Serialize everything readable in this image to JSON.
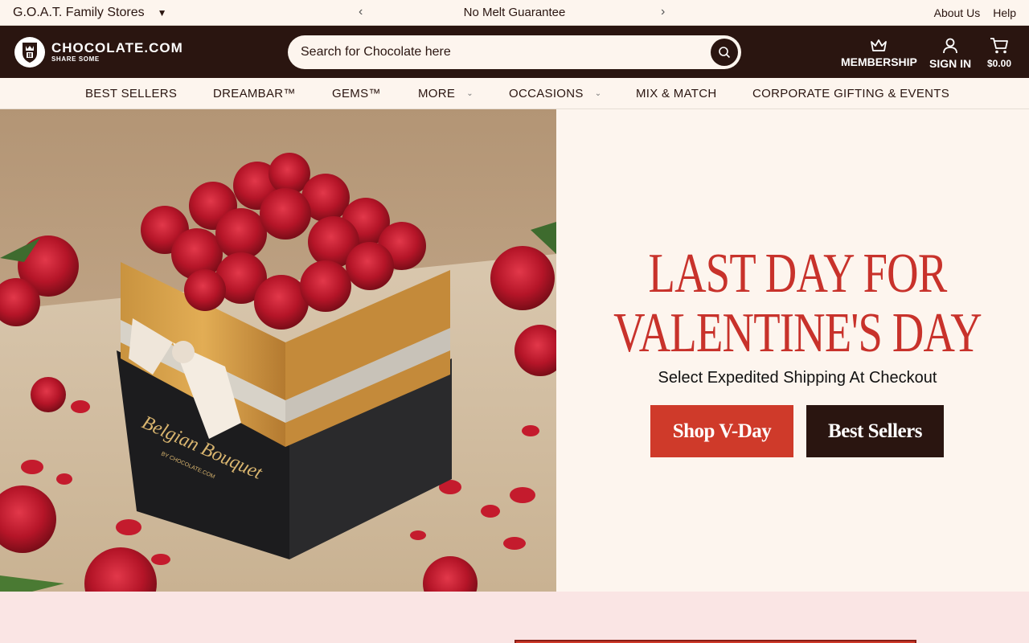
{
  "utility_bar": {
    "store_selector": "G.O.A.T. Family Stores",
    "promo_text": "No Melt Guarantee",
    "links": [
      "About Us",
      "Help"
    ]
  },
  "header": {
    "logo_name": "CHOCOLATE.COM",
    "logo_tagline": "SHARE SOME",
    "search_placeholder": "Search for Chocolate here",
    "membership_label": "MEMBERSHIP",
    "signin_label": "SIGN IN",
    "cart_total": "$0.00"
  },
  "nav": {
    "items": [
      {
        "label": "BEST SELLERS"
      },
      {
        "label": "DREAMBAR™"
      },
      {
        "label": "GEMS™"
      },
      {
        "label": "MORE"
      },
      {
        "label": "OCCASIONS"
      },
      {
        "label": "MIX & MATCH"
      },
      {
        "label": "CORPORATE GIFTING & EVENTS"
      }
    ]
  },
  "hero": {
    "title_line1": "LAST DAY FOR",
    "title_line2": "VALENTINE'S DAY",
    "subtitle": "Select Expedited Shipping At Checkout",
    "primary_button": "Shop V-Day",
    "secondary_button": "Best Sellers",
    "box_text": "Belgian Bouquet",
    "box_subtext": "BY CHOCOLATE.COM"
  },
  "colors": {
    "brand_dark": "#2a1510",
    "accent_red": "#cf3a2a",
    "cream": "#fdf5ee"
  }
}
